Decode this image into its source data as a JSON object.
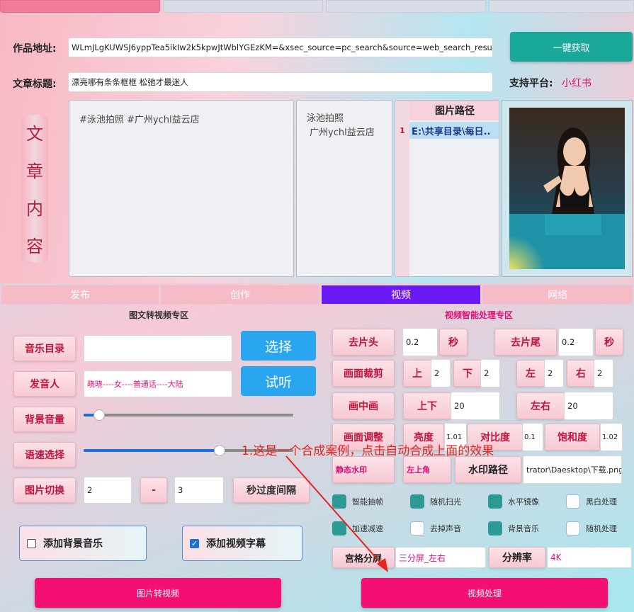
{
  "top_tabs": [
    "",
    "",
    "",
    ""
  ],
  "work_url": {
    "label": "作品地址:",
    "value": "WLmJLgKUWSJ6yppTea5ikIw2k5kpwJtWblYGEzKM=&xsec_source=pc_search&source=web_search_result_notes"
  },
  "fetch_button": "一键获取",
  "article_title": {
    "label": "文章标题:",
    "value": "漂亮哪有条条框框 松弛才最迷人"
  },
  "platform": {
    "label": "支持平台:",
    "value": "小红书"
  },
  "article_content_label": [
    "文",
    "章",
    "内",
    "容"
  ],
  "content_text": "#泳池拍照 #广州ychl益云店",
  "tags_text": [
    "泳池拍照",
    "广州ychl益云店"
  ],
  "image_table": {
    "header": "图片路径",
    "rows": [
      {
        "index": "1",
        "path": "E:\\共享目录\\每日.."
      }
    ]
  },
  "preview_image": "woman-pool-photo",
  "mid_tabs": [
    "发布",
    "创作",
    "视频",
    "网络"
  ],
  "left_section": {
    "title": "图文转视频专区",
    "music_dir": {
      "label": "音乐目录",
      "value": ""
    },
    "select_button": "选择",
    "speaker": {
      "label": "发音人",
      "value": "晓晓----女----普通话----大陆"
    },
    "listen_button": "试听",
    "bg_volume": {
      "label": "背景音量",
      "level": 0.1
    },
    "speed": {
      "label": "语速选择",
      "level": 0.66
    },
    "image_switch": {
      "label": "图片切换",
      "from": "2",
      "dash": "-",
      "to": "3",
      "interval_label": "秒过度间隔"
    },
    "add_bg_music": {
      "label": "添加背景音乐",
      "checked": false
    },
    "add_subtitle": {
      "label": "添加视频字幕",
      "checked": true
    },
    "convert_button": "图片转视频"
  },
  "right_section": {
    "title": "视频智能处理专区",
    "trim_head": {
      "label": "去片头",
      "value": "0.2",
      "unit": "秒"
    },
    "trim_tail": {
      "label": "去片尾",
      "value": "0.2",
      "unit": "秒"
    },
    "crop": {
      "label": "画面裁剪",
      "up_label": "上",
      "up": "2",
      "down_label": "下",
      "down": "2",
      "left_label": "左",
      "left": "2",
      "right_label": "右",
      "right": "2"
    },
    "pip": {
      "label": "画中画",
      "ud_label": "上下",
      "ud": "20",
      "lr_label": "左右",
      "lr": "20"
    },
    "adjust": {
      "label": "画面调整",
      "brightness_label": "亮度",
      "brightness": "1.01",
      "contrast_label": "对比度",
      "contrast": "0.1",
      "saturation_label": "饱和度",
      "saturation": "1.02"
    },
    "watermark": {
      "label": "静态水印",
      "position": "左上角",
      "path_label": "水印路径",
      "path": "trator\\Daesktop\\下载.png"
    },
    "toggles": [
      {
        "label": "智能抽帧",
        "on": true
      },
      {
        "label": "随机扫光",
        "on": true
      },
      {
        "label": "水平镜像",
        "on": true
      },
      {
        "label": "黑白处理",
        "on": false
      },
      {
        "label": "加速减速",
        "on": true
      },
      {
        "label": "去掉声音",
        "on": false
      },
      {
        "label": "背景音乐",
        "on": true
      },
      {
        "label": "随机处理",
        "on": false
      }
    ],
    "grid_split": {
      "label": "宫格分屏",
      "value": "三分屏_左右"
    },
    "resolution": {
      "label": "分辨率",
      "value": "4K"
    },
    "process_button": "视频处理"
  },
  "annotation": "1.这是一个合成案例，点击自动合成上面的效果",
  "colors": {
    "accent_pink": "#f40f72",
    "accent_blue": "#2aa5f0",
    "green": "#1aa89a",
    "purple_tab": "#6a18f5",
    "annotation_red": "#e8231f"
  }
}
